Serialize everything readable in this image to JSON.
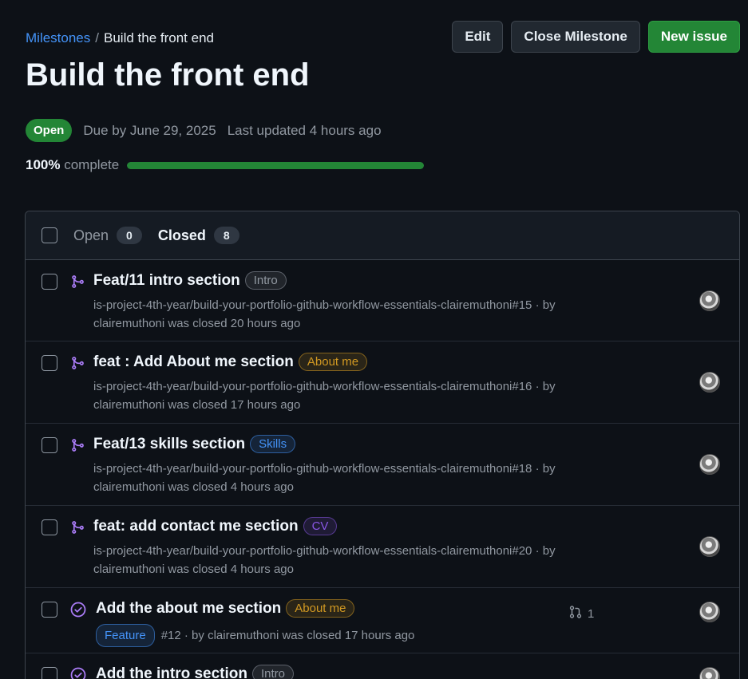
{
  "breadcrumb": {
    "parent": "Milestones",
    "separator": "/",
    "current": "Build the front end"
  },
  "actions": {
    "edit": "Edit",
    "close": "Close Milestone",
    "new_issue": "New issue"
  },
  "milestone": {
    "title": "Build the front end",
    "state": "Open",
    "due": "Due by June 29, 2025",
    "updated": "Last updated 4 hours ago",
    "percent_label": "100%",
    "complete_word": "complete",
    "progress": 1.0
  },
  "tabs": {
    "open": {
      "label": "Open",
      "count": "0"
    },
    "closed": {
      "label": "Closed",
      "count": "8"
    }
  },
  "rows": [
    {
      "kind": "pr",
      "title": "Feat/11 intro section",
      "label": "Intro",
      "label_color": "#9198a1",
      "line1": "is-project-4th-year/build-your-portfolio-github-workflow-essentials-clairemuthoni#15 · by",
      "line2": "clairemuthoni was closed 20 hours ago"
    },
    {
      "kind": "pr",
      "title": "feat : Add About me section",
      "label": "About me",
      "label_color": "#d29922",
      "line1": "is-project-4th-year/build-your-portfolio-github-workflow-essentials-clairemuthoni#16 · by",
      "line2": "clairemuthoni was closed 17 hours ago"
    },
    {
      "kind": "pr",
      "title": "Feat/13 skills section",
      "label": "Skills",
      "label_color": "#4493f8",
      "line1": "is-project-4th-year/build-your-portfolio-github-workflow-essentials-clairemuthoni#18 · by",
      "line2": "clairemuthoni was closed 4 hours ago"
    },
    {
      "kind": "pr",
      "title": "feat: add contact me section",
      "label": "CV",
      "label_color": "#8957e5",
      "line1": "is-project-4th-year/build-your-portfolio-github-workflow-essentials-clairemuthoni#20 · by",
      "line2": "clairemuthoni was closed 4 hours ago"
    },
    {
      "kind": "issue",
      "title": "Add the about me section",
      "label": "About me",
      "label_color": "#d29922",
      "tag": "Feature",
      "tag_color": "#4493f8",
      "line1": "#12 · by clairemuthoni was closed 17 hours ago",
      "linked_prs": "1"
    },
    {
      "kind": "issue",
      "title": "Add the intro section",
      "label": "Intro",
      "label_color": "#9198a1"
    }
  ],
  "colors": {
    "accent": "#4493f8",
    "success": "#238636",
    "done_purple": "#ab7df8"
  },
  "icons": [
    "git-merge-icon",
    "check-circle-icon",
    "pull-request-icon",
    "avatar"
  ]
}
